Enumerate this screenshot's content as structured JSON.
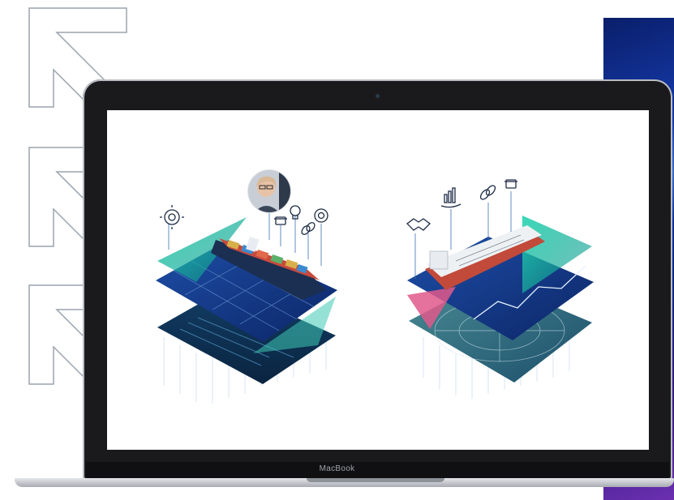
{
  "laptop": {
    "brand_label": "MacBook"
  },
  "colors": {
    "navy": "#0f2b6b",
    "teal": "#1fc4a4",
    "pink": "#e0598b",
    "accent_blue": "#2f6fd0"
  },
  "left_scene": {
    "subject": "container-ship",
    "icons": [
      "gear-chart-icon",
      "hat-icon",
      "lightbulb-icon",
      "link-icon",
      "lifebuoy-icon"
    ],
    "has_avatar": true
  },
  "right_scene": {
    "subject": "tanker-ship",
    "icons": [
      "handshake-icon",
      "bar-chart-hand-icon",
      "link-icon",
      "hat-icon"
    ]
  }
}
